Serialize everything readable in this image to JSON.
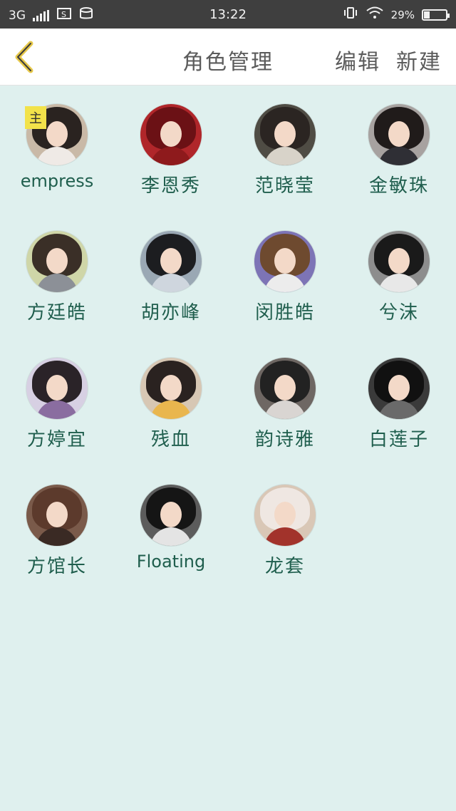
{
  "status_bar": {
    "network": "3G",
    "time": "13:22",
    "battery_text": "29%",
    "battery_level": 0.29
  },
  "nav": {
    "title": "角色管理",
    "edit_label": "编辑",
    "new_label": "新建"
  },
  "main_badge": "主",
  "roles": [
    {
      "name": "empress",
      "avatar_colors": {
        "bg": "#c9b9a7",
        "hair": "#2a2320",
        "body": "#efeae6"
      }
    },
    {
      "name": "李恩秀",
      "avatar_colors": {
        "bg": "#b0262a",
        "hair": "#6b1115",
        "body": "#8e1a1c"
      }
    },
    {
      "name": "范晓莹",
      "avatar_colors": {
        "bg": "#4f4c44",
        "hair": "#2b2522",
        "body": "#d8d3c9"
      }
    },
    {
      "name": "金敏珠",
      "avatar_colors": {
        "bg": "#a7a2a0",
        "hair": "#201b1a",
        "body": "#2f2f35"
      }
    },
    {
      "name": "方廷皓",
      "avatar_colors": {
        "bg": "#cfd6a8",
        "hair": "#3a2f27",
        "body": "#8c9097"
      }
    },
    {
      "name": "胡亦峰",
      "avatar_colors": {
        "bg": "#9aa8b4",
        "hair": "#1c1d20",
        "body": "#cfd6de"
      }
    },
    {
      "name": "闵胜皓",
      "avatar_colors": {
        "bg": "#7d74b6",
        "hair": "#6e4a2f",
        "body": "#ececec"
      }
    },
    {
      "name": "兮沫",
      "avatar_colors": {
        "bg": "#8d8d8d",
        "hair": "#1a1a1a",
        "body": "#e8e8e8"
      }
    },
    {
      "name": "方婷宜",
      "avatar_colors": {
        "bg": "#d7d0e3",
        "hair": "#2a2328",
        "body": "#8a6da0"
      }
    },
    {
      "name": "残血",
      "avatar_colors": {
        "bg": "#d7c7b4",
        "hair": "#2a2220",
        "body": "#e9b64e"
      }
    },
    {
      "name": "韵诗雅",
      "avatar_colors": {
        "bg": "#6e6763",
        "hair": "#222",
        "body": "#d9d5d2"
      }
    },
    {
      "name": "白莲子",
      "avatar_colors": {
        "bg": "#3a3a3a",
        "hair": "#111",
        "body": "#6a6a6a"
      }
    },
    {
      "name": "方馆长",
      "avatar_colors": {
        "bg": "#7a5a4a",
        "hair": "#5c3a2c",
        "body": "#3a2a24"
      }
    },
    {
      "name": "Floating",
      "avatar_colors": {
        "bg": "#5c5c5c",
        "hair": "#151515",
        "body": "#e4e4e4"
      }
    },
    {
      "name": "龙套",
      "avatar_colors": {
        "bg": "#d9c7b6",
        "hair": "#efe7e2",
        "body": "#a2332b"
      }
    }
  ],
  "colors": {
    "background": "#dff0ee",
    "name_text": "#1f5e4d",
    "back_chevron": "#e6c84a"
  }
}
